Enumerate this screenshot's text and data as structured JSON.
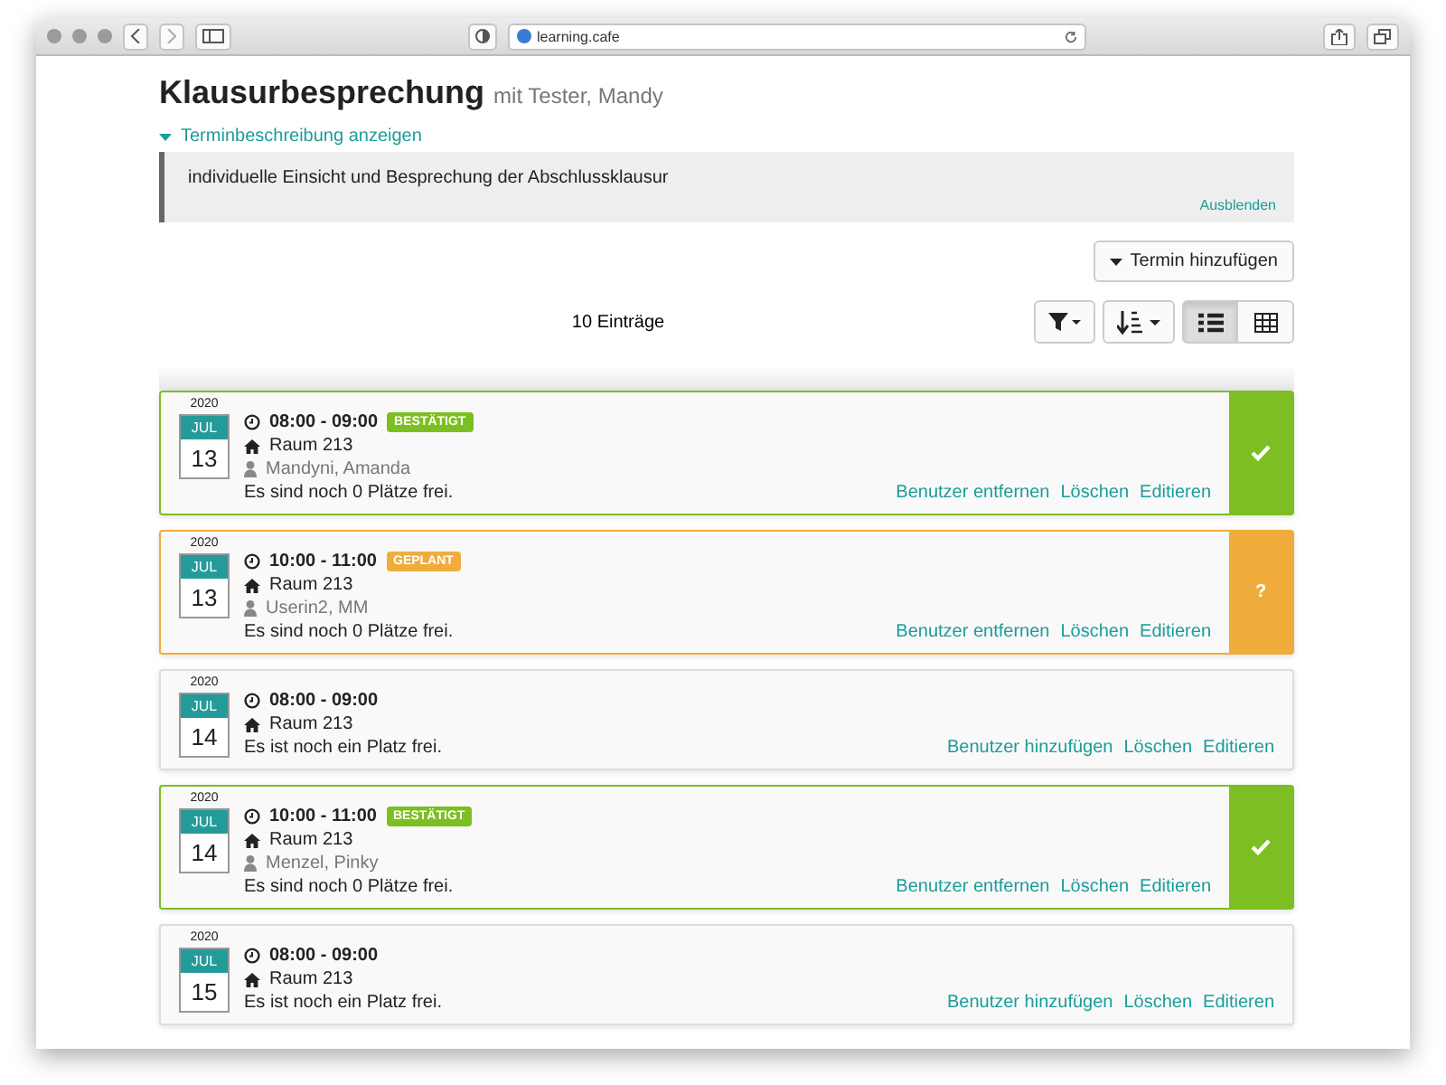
{
  "browser": {
    "url": "learning.cafe"
  },
  "title": "Klausurbesprechung",
  "subtitle": "mit Tester, Mandy",
  "description_toggle": "Terminbeschreibung anzeigen",
  "description": {
    "text": "individuelle Einsicht und Besprechung der Abschlussklausur",
    "hide_link": "Ausblenden"
  },
  "add_button": "Termin hinzufügen",
  "count": "10 Einträge",
  "view_toggle": [
    {
      "kind": "list",
      "selected": true
    },
    {
      "kind": "table",
      "selected": false
    }
  ],
  "entries": [
    {
      "kind": "confirmed",
      "year": "2020",
      "month": "JUL",
      "day": "13",
      "time": "08:00 - 09:00",
      "badge": "BESTÄTIGT",
      "room": "Raum 213",
      "user": "Mandyni, Amanda",
      "seats": "Es sind noch 0 Plätze frei.",
      "actions": [
        "Benutzer entfernen",
        "Löschen",
        "Editieren"
      ]
    },
    {
      "kind": "planned",
      "year": "2020",
      "month": "JUL",
      "day": "13",
      "time": "10:00 - 11:00",
      "badge": "GEPLANT",
      "room": "Raum 213",
      "user": "Userin2, MM",
      "seats": "Es sind noch 0 Plätze frei.",
      "actions": [
        "Benutzer entfernen",
        "Löschen",
        "Editieren"
      ],
      "side_mark": "?"
    },
    {
      "kind": "open",
      "year": "2020",
      "month": "JUL",
      "day": "14",
      "time": "08:00 - 09:00",
      "room": "Raum 213",
      "seats": "Es ist noch ein Platz frei.",
      "actions": [
        "Benutzer hinzufügen",
        "Löschen",
        "Editieren"
      ]
    },
    {
      "kind": "confirmed",
      "year": "2020",
      "month": "JUL",
      "day": "14",
      "time": "10:00 - 11:00",
      "badge": "BESTÄTIGT",
      "room": "Raum 213",
      "user": "Menzel, Pinky",
      "seats": "Es sind noch 0 Plätze frei.",
      "actions": [
        "Benutzer entfernen",
        "Löschen",
        "Editieren"
      ]
    },
    {
      "kind": "open",
      "year": "2020",
      "month": "JUL",
      "day": "15",
      "time": "08:00 - 09:00",
      "room": "Raum 213",
      "seats": "Es ist noch ein Platz frei.",
      "actions": [
        "Benutzer hinzufügen",
        "Löschen",
        "Editieren"
      ]
    }
  ]
}
